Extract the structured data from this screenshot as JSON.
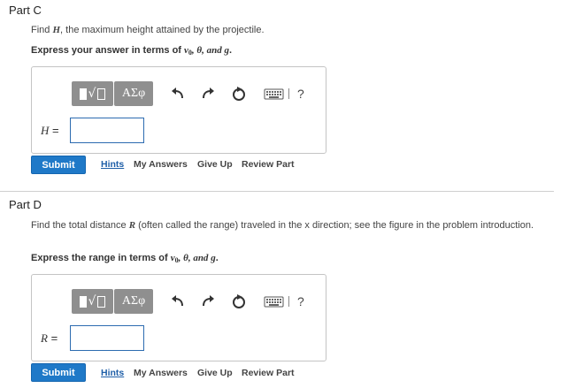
{
  "partC": {
    "title": "Part C",
    "prompt_pre": "Find ",
    "prompt_var": "H",
    "prompt_post": ", the maximum height attained by the projectile.",
    "express_pre": "Express your answer in terms of ",
    "express_vars": "v",
    "express_sub": "0",
    "express_mid": ", θ, and ",
    "express_g": "g",
    "express_end": ".",
    "var_label": "H",
    "eq": " =",
    "input_value": "",
    "submit_label": "Submit",
    "links": {
      "hints": "Hints",
      "my_answers": "My Answers",
      "give_up": "Give Up",
      "review": "Review Part"
    }
  },
  "partD": {
    "title": "Part D",
    "prompt_pre": "Find the total distance ",
    "prompt_var": "R",
    "prompt_post": " (often called the range) traveled in the x direction; see the figure in the problem introduction.",
    "express_pre": "Express the range in terms of ",
    "express_vars": "v",
    "express_sub": "0",
    "express_mid": ", θ, and ",
    "express_g": "g",
    "express_end": ".",
    "var_label": "R",
    "eq": " =",
    "input_value": "",
    "submit_label": "Submit",
    "links": {
      "hints": "Hints",
      "my_answers": "My Answers",
      "give_up": "Give Up",
      "review": "Review Part"
    }
  },
  "toolbar": {
    "greek_label": "ΑΣφ",
    "radical_symbol": "√",
    "help_label": "?"
  }
}
